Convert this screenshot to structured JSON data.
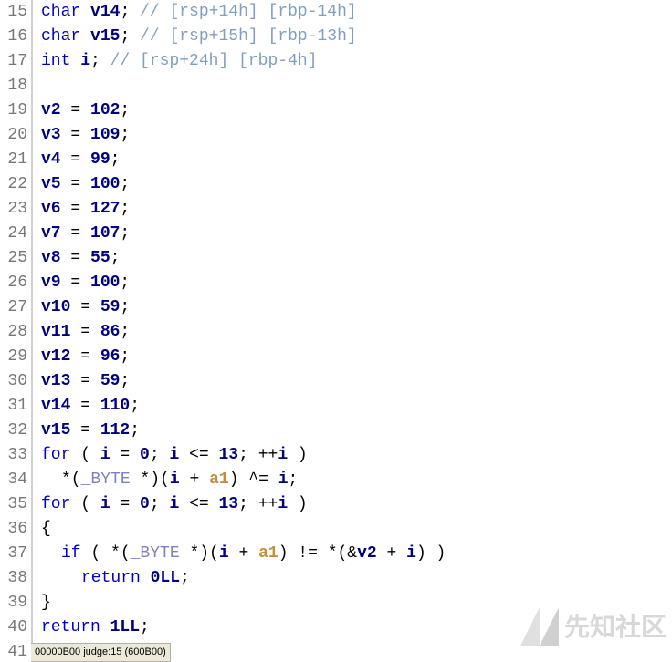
{
  "lines": {
    "start": 15,
    "count": 27,
    "nums": [
      "15",
      "16",
      "17",
      "18",
      "19",
      "20",
      "21",
      "22",
      "23",
      "24",
      "25",
      "26",
      "27",
      "28",
      "29",
      "30",
      "31",
      "32",
      "33",
      "34",
      "35",
      "36",
      "37",
      "38",
      "39",
      "40",
      "41"
    ]
  },
  "decl": {
    "kw_char": "char",
    "kw_int": "int",
    "v14": "v14",
    "v15": "v15",
    "i": "i",
    "c14": "// [rsp+14h] [rbp-14h]",
    "c15": "// [rsp+15h] [rbp-13h]",
    "ci": "// [rsp+24h] [rbp-4h]"
  },
  "assign": {
    "v2": "v2",
    "n2": "102",
    "v3": "v3",
    "n3": "109",
    "v4": "v4",
    "n4": "99",
    "v5": "v5",
    "n5": "100",
    "v6": "v6",
    "n6": "127",
    "v7": "v7",
    "n7": "107",
    "v8": "v8",
    "n8": "55",
    "v9": "v9",
    "n9": "100",
    "v10": "v10",
    "n10": "59",
    "v11": "v11",
    "n11": "86",
    "v12": "v12",
    "n12": "96",
    "v13": "v13",
    "n13": "59",
    "v14": "v14",
    "n14": "110",
    "v15": "v15",
    "n15": "112"
  },
  "loop": {
    "for": "for",
    "if": "if",
    "return": "return",
    "i": "i",
    "zero": "0",
    "limit": "13",
    "byte": "_BYTE",
    "a1": "a1",
    "v2": "v2",
    "r0": "0LL",
    "r1": "1LL"
  },
  "status": "00000B00 judge:15 (600B00)",
  "watermark": "先知社区"
}
